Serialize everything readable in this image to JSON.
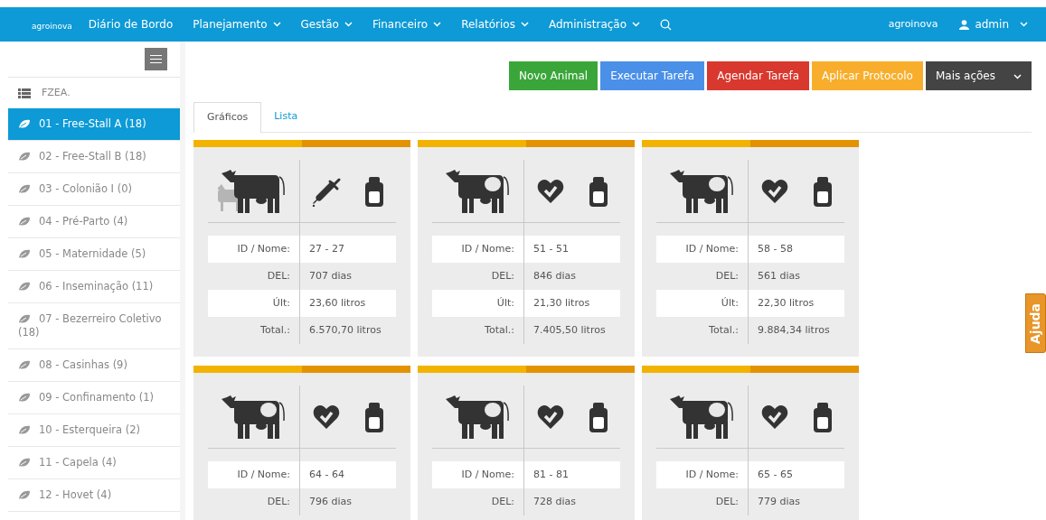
{
  "nav": {
    "logo": "agroinova",
    "items": [
      {
        "label": "Diário de Bordo",
        "dropdown": false
      },
      {
        "label": "Planejamento",
        "dropdown": true
      },
      {
        "label": "Gestão",
        "dropdown": true
      },
      {
        "label": "Financeiro",
        "dropdown": true
      },
      {
        "label": "Relatórios",
        "dropdown": true
      },
      {
        "label": "Administração",
        "dropdown": true
      }
    ],
    "right_logo": "agroinova",
    "user": "admin"
  },
  "sidebar": {
    "root": "FZEA.",
    "items": [
      {
        "label": "01 - Free-Stall A (18)",
        "selected": true
      },
      {
        "label": "02 - Free-Stall B (18)",
        "selected": false
      },
      {
        "label": "03 - Colonião I (0)",
        "selected": false
      },
      {
        "label": "04 - Pré-Parto (4)",
        "selected": false
      },
      {
        "label": "05 - Maternidade (5)",
        "selected": false
      },
      {
        "label": "06 - Inseminação (11)",
        "selected": false
      },
      {
        "label": "07 - Bezerreiro Coletivo (18)",
        "selected": false
      },
      {
        "label": "08 - Casinhas (9)",
        "selected": false
      },
      {
        "label": "09 - Confinamento (1)",
        "selected": false
      },
      {
        "label": "10 - Esterqueira (2)",
        "selected": false
      },
      {
        "label": "11 - Capela (4)",
        "selected": false
      },
      {
        "label": "12 - Hovet (4)",
        "selected": false
      }
    ]
  },
  "actions": [
    {
      "label": "Novo Animal",
      "color": "#3aa63a"
    },
    {
      "label": "Executar Tarefa",
      "color": "#4a90e8"
    },
    {
      "label": "Agendar Tarefa",
      "color": "#d9382e"
    },
    {
      "label": "Aplicar Protocolo",
      "color": "#f8ae2c"
    },
    {
      "label": "Mais ações",
      "color": "#444444"
    }
  ],
  "tabs": [
    {
      "label": "Gráficos",
      "selected": true
    },
    {
      "label": "Lista",
      "selected": false
    }
  ],
  "cards": [
    {
      "with_calf": true,
      "kind": "syringe",
      "rows": [
        {
          "label": "ID / Nome:",
          "value": "27 - 27"
        },
        {
          "label": "DEL:",
          "value": "707 dias"
        },
        {
          "label": "Últ:",
          "value": "23,60 litros"
        },
        {
          "label": "Total.:",
          "value": "6.570,70 litros"
        }
      ]
    },
    {
      "with_calf": false,
      "kind": "heart",
      "rows": [
        {
          "label": "ID / Nome:",
          "value": "51 - 51"
        },
        {
          "label": "DEL:",
          "value": "846 dias"
        },
        {
          "label": "Últ:",
          "value": "21,30 litros"
        },
        {
          "label": "Total.:",
          "value": "7.405,50 litros"
        }
      ]
    },
    {
      "with_calf": false,
      "kind": "heart",
      "rows": [
        {
          "label": "ID / Nome:",
          "value": "58 - 58"
        },
        {
          "label": "DEL:",
          "value": "561 dias"
        },
        {
          "label": "Últ:",
          "value": "22,30 litros"
        },
        {
          "label": "Total.:",
          "value": "9.884,34 litros"
        }
      ]
    },
    {
      "with_calf": false,
      "kind": "heart",
      "rows": [
        {
          "label": "ID / Nome:",
          "value": "64 - 64"
        },
        {
          "label": "DEL:",
          "value": "796 dias"
        }
      ]
    },
    {
      "with_calf": false,
      "kind": "heart",
      "rows": [
        {
          "label": "ID / Nome:",
          "value": "81 - 81"
        },
        {
          "label": "DEL:",
          "value": "728 dias"
        }
      ]
    },
    {
      "with_calf": false,
      "kind": "heart",
      "rows": [
        {
          "label": "ID / Nome:",
          "value": "65 - 65"
        },
        {
          "label": "DEL:",
          "value": "779 dias"
        }
      ]
    }
  ],
  "help_tab": "Ajuda"
}
